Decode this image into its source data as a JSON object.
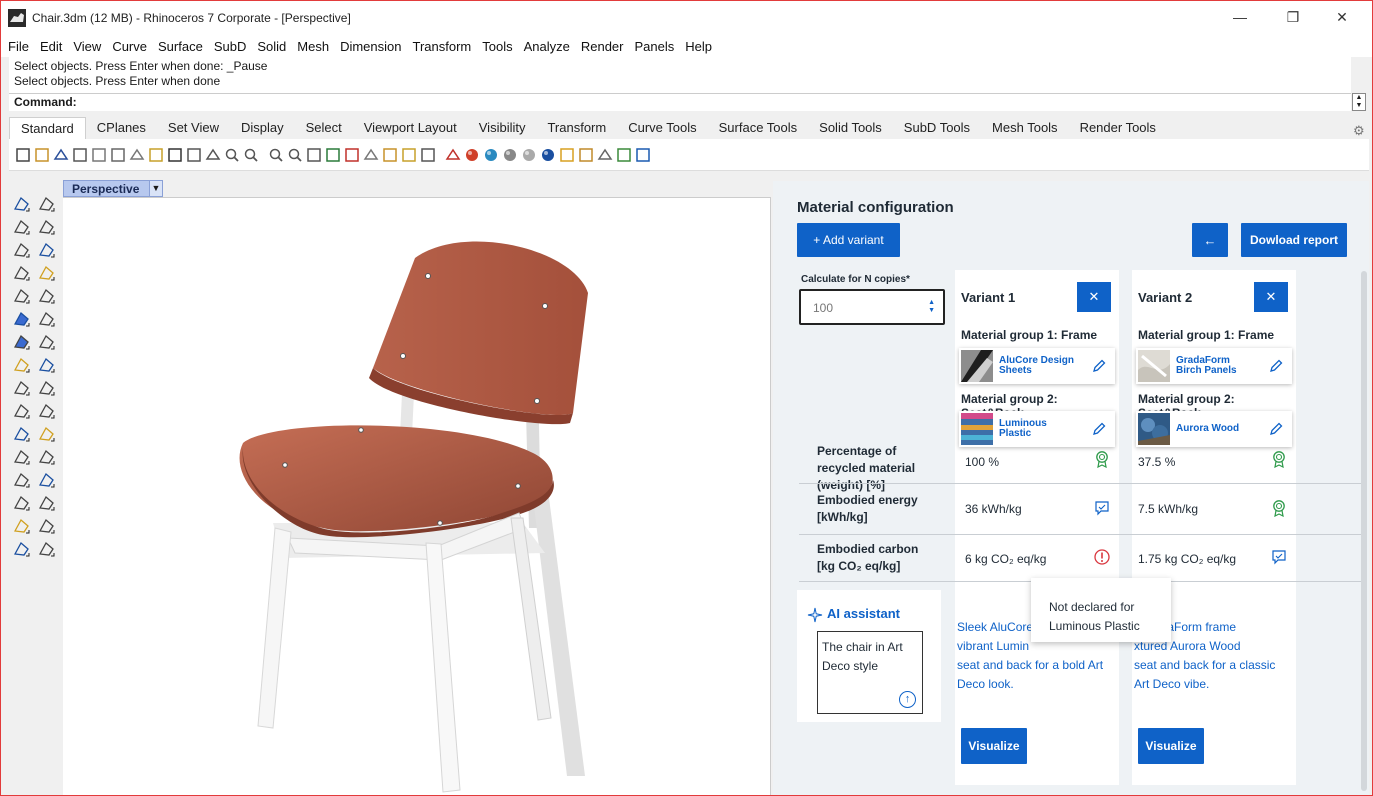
{
  "window": {
    "title": "Chair.3dm (12 MB) - Rhinoceros 7 Corporate - [Perspective]",
    "controls": {
      "minimize": "—",
      "restore": "❐",
      "close": "✕"
    }
  },
  "menu": [
    "File",
    "Edit",
    "View",
    "Curve",
    "Surface",
    "SubD",
    "Solid",
    "Mesh",
    "Dimension",
    "Transform",
    "Tools",
    "Analyze",
    "Render",
    "Panels",
    "Help"
  ],
  "command": {
    "history": [
      "Select objects. Press Enter when done: _Pause",
      "Select objects. Press Enter when done"
    ],
    "prompt": "Command:"
  },
  "toolbar_tabs": [
    "Standard",
    "CPlanes",
    "Set View",
    "Display",
    "Select",
    "Viewport Layout",
    "Visibility",
    "Transform",
    "Curve Tools",
    "Surface Tools",
    "Solid Tools",
    "SubD Tools",
    "Mesh Tools",
    "Render Tools"
  ],
  "viewport": {
    "label": "Perspective"
  },
  "panel": {
    "title": "Material configuration",
    "add_variant": "+ Add variant",
    "back": "←",
    "download": "Dowload report",
    "copies_label": "Calculate for N copies*",
    "copies_value": "100",
    "rows": {
      "recycled": "Percentage of recycled material (weight) [%]",
      "energy": "Embodied energy [kWh/kg]",
      "carbon": "Embodied carbon [kg CO₂ eq/kg]"
    },
    "ai": {
      "title": "AI assistant",
      "prompt": "The chair in Art Deco style",
      "send_icon": "↑"
    },
    "tooltip": "Not declared for Luminous Plastic",
    "variants": [
      {
        "title": "Variant 1",
        "remove": "✕",
        "group1_label": "Material group 1: Frame",
        "group1_material": "AluCore Design Sheets",
        "group2_label": "Material group 2: Seat&Back",
        "group2_material": "Luminous Plastic",
        "recycled": "100 %",
        "recycled_icon": "award-icon",
        "energy": "36 kWh/kg",
        "energy_icon": "comment-icon",
        "carbon": "6 kg CO₂ eq/kg",
        "carbon_icon": "warning-icon",
        "description": "Sleek AluCore vibrant Lumin seat and back for a bold Art Deco look.",
        "desc_lines": [
          "Sleek AluCore",
          "vibrant Lumin",
          "seat and back for a bold Art",
          "Deco look."
        ],
        "visualize": "Visualize"
      },
      {
        "title": "Variant 2",
        "remove": "✕",
        "group1_label": "Material group 1: Frame",
        "group1_material": "GradaForm Birch Panels",
        "group2_label": "Material group 2: Seat&Back",
        "group2_material": "Aurora Wood",
        "recycled": "37.5 %",
        "recycled_icon": "award-icon",
        "energy": "7.5 kWh/kg",
        "energy_icon": "award-icon",
        "carbon": "1.75 kg CO₂ eq/kg",
        "carbon_icon": "comment-icon",
        "description": "t GradaForm frame xtured Aurora Wood seat and back for a classic Art Deco vibe.",
        "desc_lines": [
          "t GradaForm frame",
          "xtured Aurora Wood",
          "seat and back for a classic",
          "Art Deco vibe."
        ],
        "visualize": "Visualize"
      }
    ]
  },
  "colors": {
    "accent": "#0f62c8",
    "seat": "#b65e46",
    "frame": "#f2f2f2",
    "warning": "#d9363e",
    "award": "#2e9a4a"
  }
}
